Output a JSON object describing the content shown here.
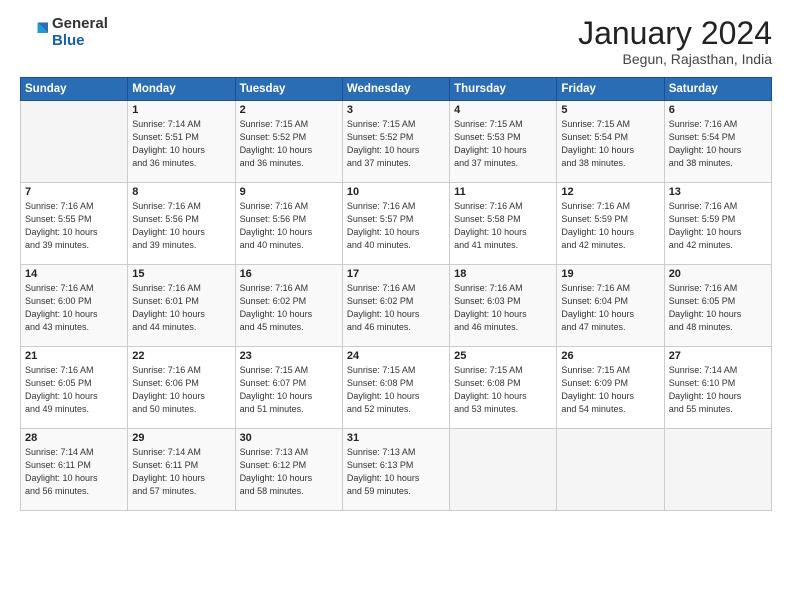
{
  "logo": {
    "general": "General",
    "blue": "Blue"
  },
  "header": {
    "month": "January 2024",
    "location": "Begun, Rajasthan, India"
  },
  "weekdays": [
    "Sunday",
    "Monday",
    "Tuesday",
    "Wednesday",
    "Thursday",
    "Friday",
    "Saturday"
  ],
  "weeks": [
    [
      {
        "day": "",
        "info": ""
      },
      {
        "day": "1",
        "info": "Sunrise: 7:14 AM\nSunset: 5:51 PM\nDaylight: 10 hours\nand 36 minutes."
      },
      {
        "day": "2",
        "info": "Sunrise: 7:15 AM\nSunset: 5:52 PM\nDaylight: 10 hours\nand 36 minutes."
      },
      {
        "day": "3",
        "info": "Sunrise: 7:15 AM\nSunset: 5:52 PM\nDaylight: 10 hours\nand 37 minutes."
      },
      {
        "day": "4",
        "info": "Sunrise: 7:15 AM\nSunset: 5:53 PM\nDaylight: 10 hours\nand 37 minutes."
      },
      {
        "day": "5",
        "info": "Sunrise: 7:15 AM\nSunset: 5:54 PM\nDaylight: 10 hours\nand 38 minutes."
      },
      {
        "day": "6",
        "info": "Sunrise: 7:16 AM\nSunset: 5:54 PM\nDaylight: 10 hours\nand 38 minutes."
      }
    ],
    [
      {
        "day": "7",
        "info": "Sunrise: 7:16 AM\nSunset: 5:55 PM\nDaylight: 10 hours\nand 39 minutes."
      },
      {
        "day": "8",
        "info": "Sunrise: 7:16 AM\nSunset: 5:56 PM\nDaylight: 10 hours\nand 39 minutes."
      },
      {
        "day": "9",
        "info": "Sunrise: 7:16 AM\nSunset: 5:56 PM\nDaylight: 10 hours\nand 40 minutes."
      },
      {
        "day": "10",
        "info": "Sunrise: 7:16 AM\nSunset: 5:57 PM\nDaylight: 10 hours\nand 40 minutes."
      },
      {
        "day": "11",
        "info": "Sunrise: 7:16 AM\nSunset: 5:58 PM\nDaylight: 10 hours\nand 41 minutes."
      },
      {
        "day": "12",
        "info": "Sunrise: 7:16 AM\nSunset: 5:59 PM\nDaylight: 10 hours\nand 42 minutes."
      },
      {
        "day": "13",
        "info": "Sunrise: 7:16 AM\nSunset: 5:59 PM\nDaylight: 10 hours\nand 42 minutes."
      }
    ],
    [
      {
        "day": "14",
        "info": "Sunrise: 7:16 AM\nSunset: 6:00 PM\nDaylight: 10 hours\nand 43 minutes."
      },
      {
        "day": "15",
        "info": "Sunrise: 7:16 AM\nSunset: 6:01 PM\nDaylight: 10 hours\nand 44 minutes."
      },
      {
        "day": "16",
        "info": "Sunrise: 7:16 AM\nSunset: 6:02 PM\nDaylight: 10 hours\nand 45 minutes."
      },
      {
        "day": "17",
        "info": "Sunrise: 7:16 AM\nSunset: 6:02 PM\nDaylight: 10 hours\nand 46 minutes."
      },
      {
        "day": "18",
        "info": "Sunrise: 7:16 AM\nSunset: 6:03 PM\nDaylight: 10 hours\nand 46 minutes."
      },
      {
        "day": "19",
        "info": "Sunrise: 7:16 AM\nSunset: 6:04 PM\nDaylight: 10 hours\nand 47 minutes."
      },
      {
        "day": "20",
        "info": "Sunrise: 7:16 AM\nSunset: 6:05 PM\nDaylight: 10 hours\nand 48 minutes."
      }
    ],
    [
      {
        "day": "21",
        "info": "Sunrise: 7:16 AM\nSunset: 6:05 PM\nDaylight: 10 hours\nand 49 minutes."
      },
      {
        "day": "22",
        "info": "Sunrise: 7:16 AM\nSunset: 6:06 PM\nDaylight: 10 hours\nand 50 minutes."
      },
      {
        "day": "23",
        "info": "Sunrise: 7:15 AM\nSunset: 6:07 PM\nDaylight: 10 hours\nand 51 minutes."
      },
      {
        "day": "24",
        "info": "Sunrise: 7:15 AM\nSunset: 6:08 PM\nDaylight: 10 hours\nand 52 minutes."
      },
      {
        "day": "25",
        "info": "Sunrise: 7:15 AM\nSunset: 6:08 PM\nDaylight: 10 hours\nand 53 minutes."
      },
      {
        "day": "26",
        "info": "Sunrise: 7:15 AM\nSunset: 6:09 PM\nDaylight: 10 hours\nand 54 minutes."
      },
      {
        "day": "27",
        "info": "Sunrise: 7:14 AM\nSunset: 6:10 PM\nDaylight: 10 hours\nand 55 minutes."
      }
    ],
    [
      {
        "day": "28",
        "info": "Sunrise: 7:14 AM\nSunset: 6:11 PM\nDaylight: 10 hours\nand 56 minutes."
      },
      {
        "day": "29",
        "info": "Sunrise: 7:14 AM\nSunset: 6:11 PM\nDaylight: 10 hours\nand 57 minutes."
      },
      {
        "day": "30",
        "info": "Sunrise: 7:13 AM\nSunset: 6:12 PM\nDaylight: 10 hours\nand 58 minutes."
      },
      {
        "day": "31",
        "info": "Sunrise: 7:13 AM\nSunset: 6:13 PM\nDaylight: 10 hours\nand 59 minutes."
      },
      {
        "day": "",
        "info": ""
      },
      {
        "day": "",
        "info": ""
      },
      {
        "day": "",
        "info": ""
      }
    ]
  ]
}
